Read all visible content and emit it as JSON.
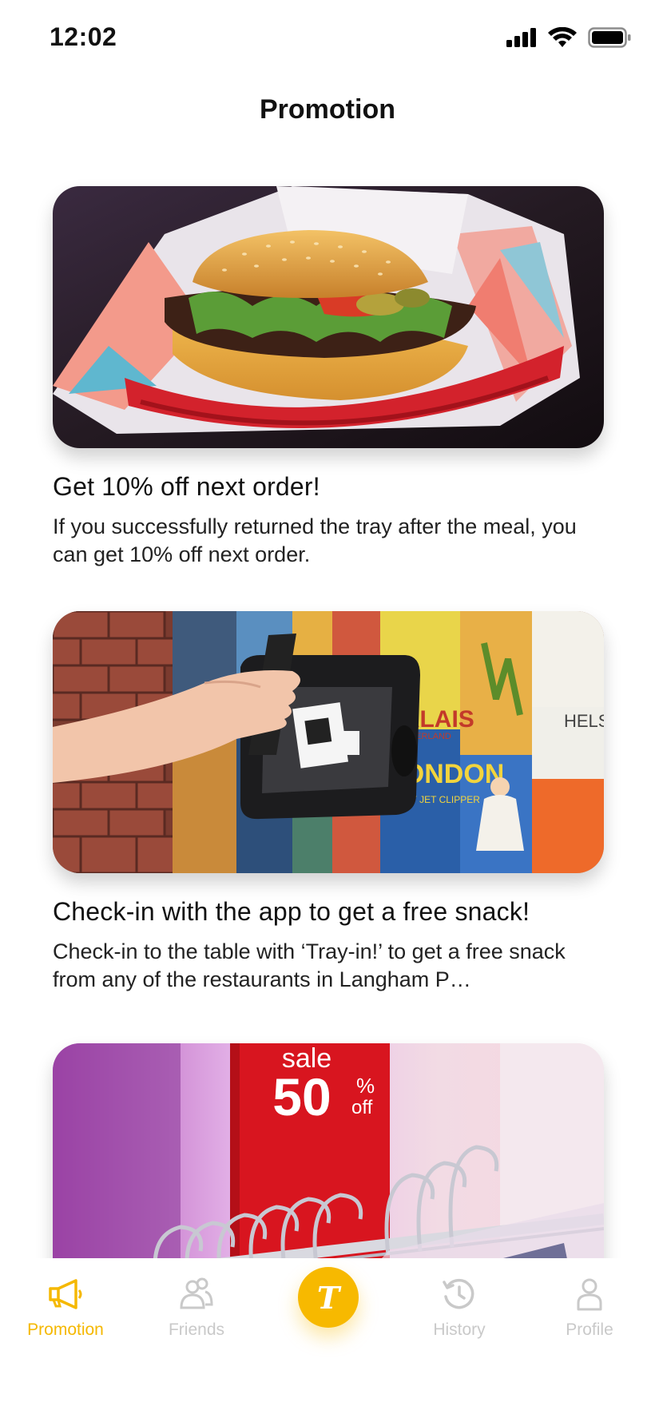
{
  "status_bar": {
    "time": "12:02"
  },
  "header": {
    "title": "Promotion"
  },
  "promotions": [
    {
      "title": "Get 10% off next order!",
      "description": "If you successfully returned the tray after the meal, you can get 10% off next order."
    },
    {
      "title": "Check-in with the app to get a free snack!",
      "description": "Check-in to the table with ‘Tray-in!’ to get a free snack from any of the restaurants in Langham P…"
    },
    {
      "sign_word": "sale",
      "sign_number": "50",
      "sign_percent": "%",
      "sign_off": "off"
    }
  ],
  "poster_text": {
    "valais": "VALAIS",
    "switzerland": "SWITZERLAND",
    "london": "LONDON",
    "clipper": "BY JET CLIPPER",
    "helsinki": "HELS"
  },
  "tab_bar": {
    "items": [
      {
        "label": "Promotion",
        "icon": "megaphone-icon"
      },
      {
        "label": "Friends",
        "icon": "friends-icon"
      },
      {
        "label": "History",
        "icon": "history-icon"
      },
      {
        "label": "Profile",
        "icon": "profile-icon"
      }
    ],
    "center_glyph": "T"
  },
  "colors": {
    "accent": "#f7b900",
    "inactive": "#c9c9c9",
    "text": "#111111"
  }
}
